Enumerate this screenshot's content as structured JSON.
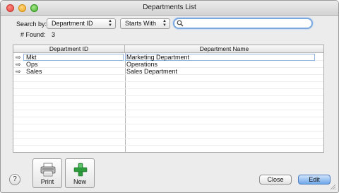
{
  "window": {
    "title": "Departments List"
  },
  "search": {
    "label": "Search by:",
    "field": "Department ID",
    "mode": "Starts With",
    "value": "",
    "found_label": "# Found:",
    "found_count": "3"
  },
  "table": {
    "columns": [
      "Department ID",
      "Department Name"
    ],
    "rows": [
      {
        "id": "Mkt",
        "name": "Marketing Department"
      },
      {
        "id": "Ops",
        "name": "Operations"
      },
      {
        "id": "Sales",
        "name": "Sales Department"
      }
    ],
    "row_icon": "right-arrow-icon"
  },
  "toolbar": {
    "print_label": "Print",
    "new_label": "New"
  },
  "footer": {
    "help_label": "?",
    "close_label": "Close",
    "edit_label": "Edit"
  },
  "colors": {
    "accent": "#6fa8ea",
    "new_icon": "#2e9b3c"
  }
}
